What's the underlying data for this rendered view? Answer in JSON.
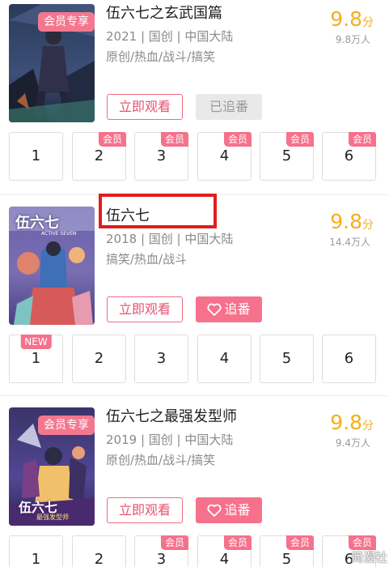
{
  "items": [
    {
      "title": "伍六七之玄武国篇",
      "meta": "2021 | 国创 | 中国大陆",
      "tags": "原创/热血/战斗/搞笑",
      "score": "9.8",
      "score_unit": "分",
      "heat": "9.8万人",
      "poster_badge": "会员专享",
      "watch_label": "立即观看",
      "follow_label": "已追番",
      "follow_state": "followed",
      "episodes": [
        {
          "num": "1",
          "badge": ""
        },
        {
          "num": "2",
          "badge": "会员"
        },
        {
          "num": "3",
          "badge": "会员"
        },
        {
          "num": "4",
          "badge": "会员"
        },
        {
          "num": "5",
          "badge": "会员"
        },
        {
          "num": "6",
          "badge": "会员"
        }
      ]
    },
    {
      "title": "伍六七",
      "meta": "2018 | 国创 | 中国大陆",
      "tags": "搞笑/热血/战斗",
      "score": "9.8",
      "score_unit": "分",
      "heat": "14.4万人",
      "poster_badge": "",
      "poster_text_1": "伍六七",
      "poster_text_2": "ACTIVE SEVEN",
      "watch_label": "立即观看",
      "follow_label": "追番",
      "follow_state": "not-followed",
      "episodes": [
        {
          "num": "1",
          "badge": "NEW"
        },
        {
          "num": "2",
          "badge": ""
        },
        {
          "num": "3",
          "badge": ""
        },
        {
          "num": "4",
          "badge": ""
        },
        {
          "num": "5",
          "badge": ""
        },
        {
          "num": "6",
          "badge": ""
        }
      ]
    },
    {
      "title": "伍六七之最强发型师",
      "meta": "2019 | 国创 | 中国大陆",
      "tags": "原创/热血/战斗/搞笑",
      "score": "9.8",
      "score_unit": "分",
      "heat": "9.4万人",
      "poster_badge": "会员专享",
      "poster_text_1": "伍六七",
      "poster_text_2": "最强发型师",
      "watch_label": "立即观看",
      "follow_label": "追番",
      "follow_state": "not-followed",
      "episodes": [
        {
          "num": "1",
          "badge": ""
        },
        {
          "num": "2",
          "badge": ""
        },
        {
          "num": "3",
          "badge": "会员"
        },
        {
          "num": "4",
          "badge": "会员"
        },
        {
          "num": "5",
          "badge": "会员"
        },
        {
          "num": "6",
          "badge": "会员"
        }
      ]
    }
  ],
  "watermark": "简漫社",
  "colors": {
    "accent_pink": "#f6718b",
    "score_gold": "#f4ae1e",
    "highlight_red": "#e31d1d",
    "meta_gray": "#8a8a8a"
  }
}
